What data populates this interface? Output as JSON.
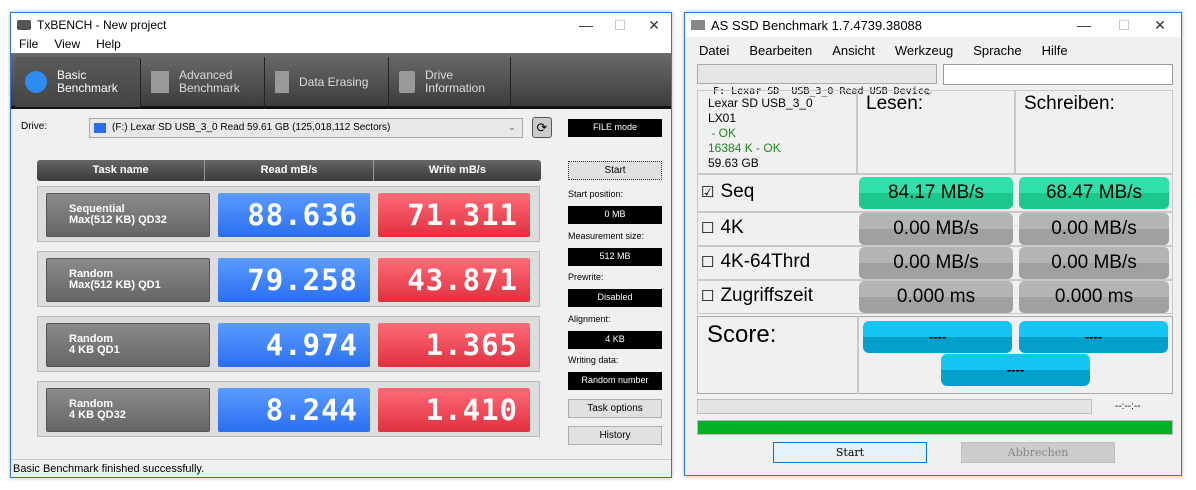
{
  "txbench": {
    "title": "TxBENCH - New project",
    "menu": [
      "File",
      "View",
      "Help"
    ],
    "tabs": [
      {
        "label1": "Basic",
        "label2": "Benchmark"
      },
      {
        "label1": "Advanced",
        "label2": "Benchmark"
      },
      {
        "label1": "Data Erasing",
        "label2": ""
      },
      {
        "label1": "Drive",
        "label2": "Information"
      }
    ],
    "drive_label": "Drive:",
    "drive_value": "(F:) Lexar SD  USB_3_0 Read  59.61 GB (125,018,112 Sectors)",
    "mode": "FILE mode",
    "columns": [
      "Task name",
      "Read mB/s",
      "Write mB/s"
    ],
    "rows": [
      {
        "name1": "Sequential",
        "name2": "Max(512 KB) QD32",
        "read": "88.636",
        "write": "71.311"
      },
      {
        "name1": "Random",
        "name2": "Max(512 KB) QD1",
        "read": "79.258",
        "write": "43.871"
      },
      {
        "name1": "Random",
        "name2": "4 KB QD1",
        "read": "4.974",
        "write": "1.365"
      },
      {
        "name1": "Random",
        "name2": "4 KB QD32",
        "read": "8.244",
        "write": "1.410"
      }
    ],
    "start": "Start",
    "settings": [
      {
        "label": "Start position:",
        "value": "0 MB"
      },
      {
        "label": "Measurement size:",
        "value": "512 MB"
      },
      {
        "label": "Prewrite:",
        "value": "Disabled"
      },
      {
        "label": "Alignment:",
        "value": "4 KB"
      },
      {
        "label": "Writing data:",
        "value": "Random number"
      }
    ],
    "task_options": "Task options",
    "history": "History",
    "status": "Basic Benchmark finished successfully."
  },
  "asssd": {
    "title": "AS SSD Benchmark 1.7.4739.38088",
    "menu": [
      "Datei",
      "Bearbeiten",
      "Ansicht",
      "Werkzeug",
      "Sprache",
      "Hilfe"
    ],
    "device": "F: Lexar SD  USB_3_0 Read USB Device",
    "info": {
      "name": "Lexar SD  USB_3_0",
      "fw": "LX01",
      "ok1": " - OK",
      "ok2": "16384 K - OK",
      "size": "59.63 GB"
    },
    "read_header": "Lesen:",
    "write_header": "Schreiben:",
    "rows": [
      {
        "label": "Seq",
        "checked": true,
        "check": "☑",
        "read": "84.17 MB/s",
        "write": "68.47 MB/s"
      },
      {
        "label": "4K",
        "checked": false,
        "check": "☐",
        "read": "0.00 MB/s",
        "write": "0.00 MB/s"
      },
      {
        "label": "4K-64Thrd",
        "checked": false,
        "check": "☐",
        "read": "0.00 MB/s",
        "write": "0.00 MB/s"
      },
      {
        "label": "Zugriffszeit",
        "checked": false,
        "check": "☐",
        "read": "0.000 ms",
        "write": "0.000 ms"
      }
    ],
    "score_label": "Score:",
    "score_read": "----",
    "score_write": "----",
    "score_total": "----",
    "time": "--:--:--",
    "progress": 1.0,
    "start": "Start",
    "cancel": "Abbrechen",
    "colors": {
      "ok": "#1a8a1a",
      "progress": "#06b025"
    }
  }
}
